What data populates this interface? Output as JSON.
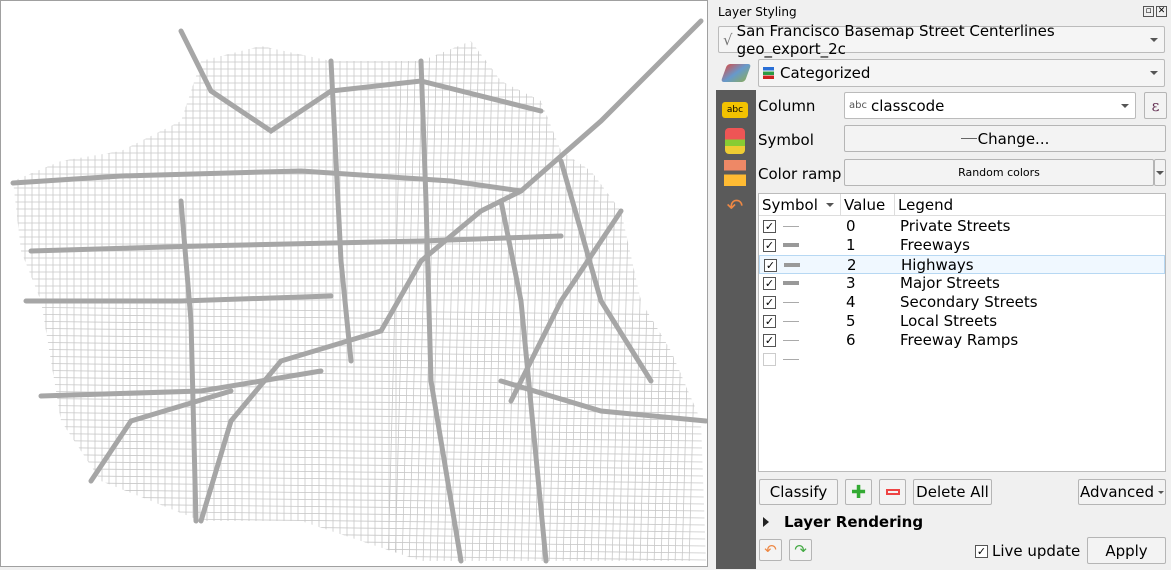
{
  "panel": {
    "title": "Layer Styling",
    "layer": "San Francisco Basemap Street Centerlines geo_export_2c",
    "renderer": "Categorized",
    "column_label": "Column",
    "column_value": "classcode",
    "column_type": "abc",
    "symbol_label": "Symbol",
    "symbol_button": "Change...",
    "ramp_label": "Color ramp",
    "ramp_value": "Random colors",
    "headers": {
      "symbol": "Symbol",
      "value": "Value",
      "legend": "Legend"
    },
    "rows": [
      {
        "checked": true,
        "value": "0",
        "legend": "Private Streets",
        "thick": false
      },
      {
        "checked": true,
        "value": "1",
        "legend": "Freeways",
        "thick": true
      },
      {
        "checked": true,
        "value": "2",
        "legend": "Highways",
        "thick": true,
        "selected": true
      },
      {
        "checked": true,
        "value": "3",
        "legend": "Major Streets",
        "thick": true
      },
      {
        "checked": true,
        "value": "4",
        "legend": "Secondary Streets",
        "thick": false
      },
      {
        "checked": true,
        "value": "5",
        "legend": "Local Streets",
        "thick": false
      },
      {
        "checked": true,
        "value": "6",
        "legend": "Freeway Ramps",
        "thick": false
      },
      {
        "checked": false,
        "value": "",
        "legend": "",
        "thick": false
      }
    ],
    "classify": "Classify",
    "delete_all": "Delete All",
    "advanced": "Advanced",
    "layer_rendering": "Layer Rendering",
    "live_update": "Live update",
    "live_update_checked": true,
    "apply": "Apply"
  },
  "colors": {
    "street": "#a6a6a6",
    "sidebar": "#5a5a5a",
    "selection": "#f0f8ff"
  }
}
